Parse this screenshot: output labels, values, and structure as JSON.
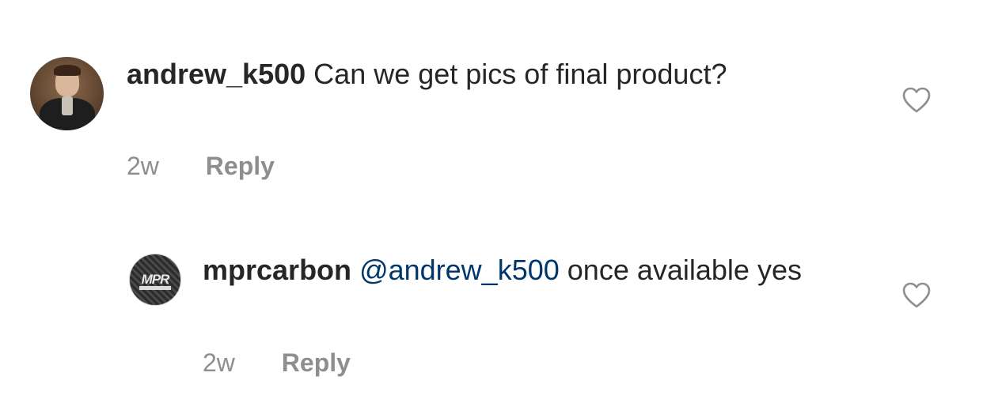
{
  "comments": [
    {
      "username": "andrew_k500",
      "text": "Can we get pics of final product?",
      "time": "2w",
      "reply_label": "Reply",
      "avatar": "user-photo-avatar",
      "like_icon": "heart-outline-icon"
    }
  ],
  "reply": {
    "username": "mprcarbon",
    "mention": "@andrew_k500",
    "text": "once available yes",
    "time": "2w",
    "reply_label": "Reply",
    "avatar": "carbon-logo-avatar",
    "like_icon": "heart-outline-icon",
    "logo_text": "MPR",
    "logo_subtext": "PERFORMANCE"
  },
  "colors": {
    "text": "#262626",
    "meta": "#8e8e8e",
    "mention": "#00376b",
    "logo_accent": "#d32f2f"
  }
}
